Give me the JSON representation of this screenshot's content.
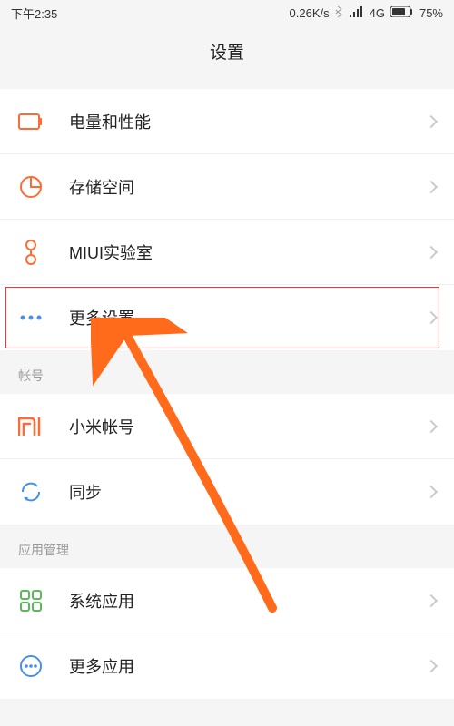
{
  "status_bar": {
    "time": "下午2:35",
    "data_rate": "0.26K/s",
    "network": "4G",
    "battery": "75%"
  },
  "header": {
    "title": "设置"
  },
  "sections": {
    "system_items": [
      {
        "id": "battery",
        "label": "电量和性能"
      },
      {
        "id": "storage",
        "label": "存储空间"
      },
      {
        "id": "miui_lab",
        "label": "MIUI实验室"
      },
      {
        "id": "more_settings",
        "label": "更多设置"
      }
    ],
    "account_header": "帐号",
    "account_items": [
      {
        "id": "mi_account",
        "label": "小米帐号"
      },
      {
        "id": "sync",
        "label": "同步"
      }
    ],
    "apps_header": "应用管理",
    "apps_items": [
      {
        "id": "system_apps",
        "label": "系统应用"
      },
      {
        "id": "more_apps",
        "label": "更多应用"
      }
    ]
  },
  "annotation": {
    "highlighted_item": "more_settings"
  }
}
